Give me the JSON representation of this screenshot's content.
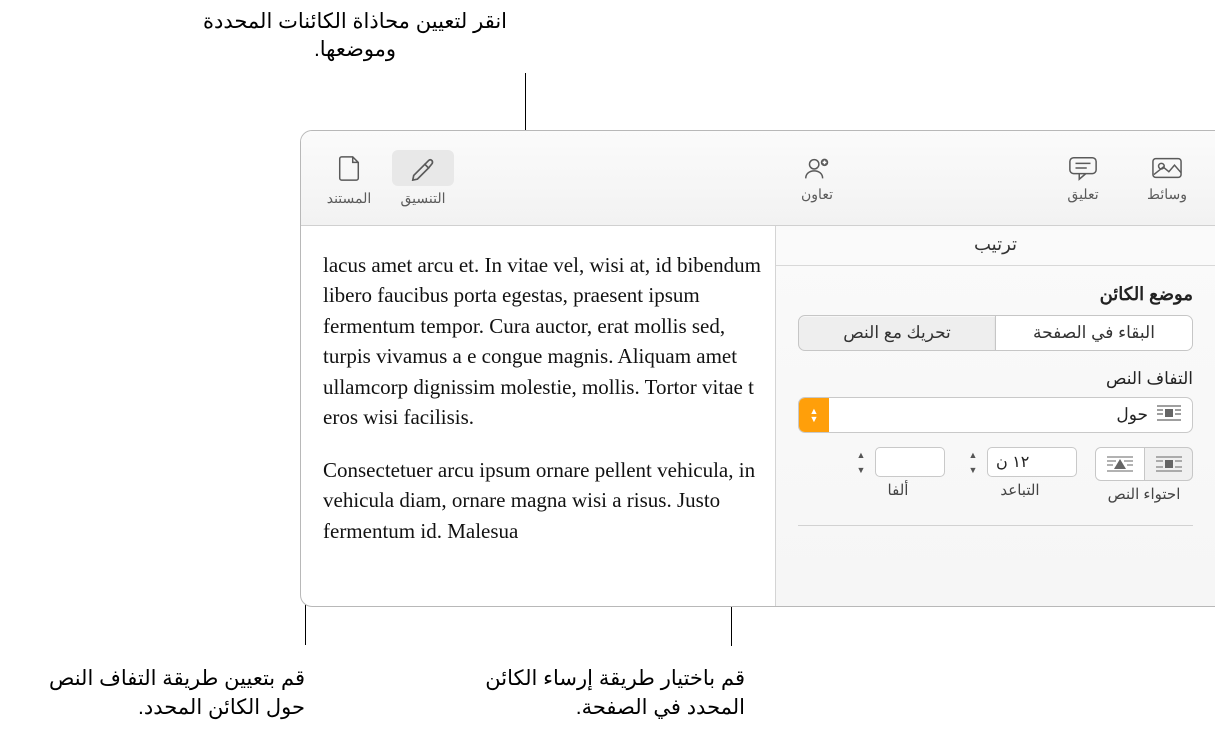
{
  "callouts": {
    "top": "انقر لتعيين محاذاة الكائنات المحددة وموضعها.",
    "bottom_right": "قم باختيار طريقة إرساء الكائن المحدد في الصفحة.",
    "bottom_left": "قم بتعيين طريقة التفاف النص حول الكائن المحدد."
  },
  "toolbar": {
    "media": "وسائط",
    "comment": "تعليق",
    "collaborate": "تعاون",
    "format": "التنسيق",
    "document": "المستند"
  },
  "inspector": {
    "tab": "ترتيب",
    "object_position_title": "موضع الكائن",
    "seg_stay": "البقاء في الصفحة",
    "seg_move": "تحريك مع النص",
    "wrap_title": "التفاف النص",
    "wrap_value": "حول",
    "fit_label": "احتواء النص",
    "spacing_label": "التباعد",
    "spacing_value": "١٢ ن",
    "alpha_label": "ألفا"
  },
  "document_text": {
    "p1": "lacus amet arcu et. In vitae vel, wisi at, id bibendum libero faucibus porta egestas, praesent ipsum fermentum tempor. Cura auctor, erat mollis sed, turpis vivamus a e congue magnis. Aliquam amet ullamcorp dignissim molestie, mollis. Tortor vitae t eros wisi facilisis.",
    "p2": "Consectetuer arcu ipsum ornare pellent vehicula, in vehicula diam, ornare magna wisi a risus. Justo fermentum id. Malesua"
  }
}
